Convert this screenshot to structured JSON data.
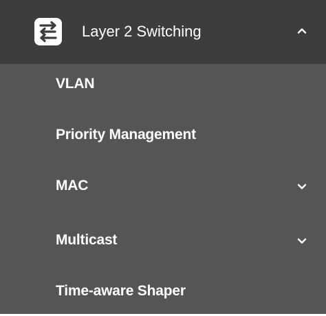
{
  "menu": {
    "section": {
      "label": "Layer 2 Switching",
      "icon": "switch-arrows-icon",
      "expanded": true,
      "chevron_icon": "chevron-up-icon"
    },
    "items": [
      {
        "label": "VLAN",
        "has_submenu": false
      },
      {
        "label": "Priority Management",
        "has_submenu": false
      },
      {
        "label": "MAC",
        "has_submenu": true,
        "chevron_icon": "chevron-down-icon"
      },
      {
        "label": "Multicast",
        "has_submenu": true,
        "chevron_icon": "chevron-down-icon"
      },
      {
        "label": "Time-aware Shaper",
        "has_submenu": false
      }
    ]
  },
  "colors": {
    "panel_background": "#555555",
    "header_background": "#3d3d3d",
    "text": "#ffffff",
    "icon_tile": "#ffffff",
    "icon_glyph": "#3d3d3d"
  }
}
